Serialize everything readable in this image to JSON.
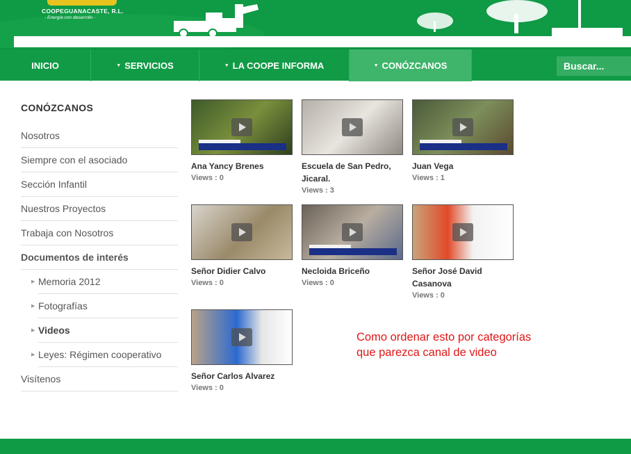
{
  "header": {
    "logo_name": "COOPEGUANACASTE, R.L.",
    "logo_tagline": "- Energía con desarrollo -"
  },
  "nav": {
    "items": [
      {
        "label": "INICIO",
        "caret": false
      },
      {
        "label": "SERVICIOS",
        "caret": true
      },
      {
        "label": "LA COOPE INFORMA",
        "caret": true
      },
      {
        "label": "CONÓZCANOS",
        "caret": true,
        "active": true
      }
    ],
    "search_placeholder": "Buscar..."
  },
  "sidebar": {
    "title": "CONÓZCANOS",
    "items": [
      {
        "label": "Nosotros"
      },
      {
        "label": "Siempre con el asociado"
      },
      {
        "label": "Sección Infantil"
      },
      {
        "label": "Nuestros Proyectos"
      },
      {
        "label": "Trabaja con Nosotros"
      },
      {
        "label": "Documentos de interés"
      },
      {
        "label": "Memoria 2012"
      },
      {
        "label": "Fotografías"
      },
      {
        "label": "Videos"
      },
      {
        "label": "Leyes: Régimen cooperativo"
      },
      {
        "label": "Visítenos"
      }
    ]
  },
  "videos": {
    "views_label": "Views :",
    "items": [
      {
        "title": "Ana Yancy Brenes",
        "views": "0"
      },
      {
        "title": "Escuela de San Pedro, Jicaral.",
        "views": "3"
      },
      {
        "title": "Juan Vega",
        "views": "1"
      },
      {
        "title": "Señor Didier Calvo",
        "views": "0"
      },
      {
        "title": "Necloida Briceño",
        "views": "0"
      },
      {
        "title": "Señor José David Casanova",
        "views": "0"
      },
      {
        "title": "Señor Carlos Alvarez",
        "views": "0"
      }
    ]
  },
  "note": {
    "line1": "Como ordenar esto por categorías",
    "line2": "que parezca canal de video"
  },
  "colors": {
    "brand_green": "#0f9a45",
    "active_nav": "#3fb56c",
    "note_red": "#e01717"
  }
}
